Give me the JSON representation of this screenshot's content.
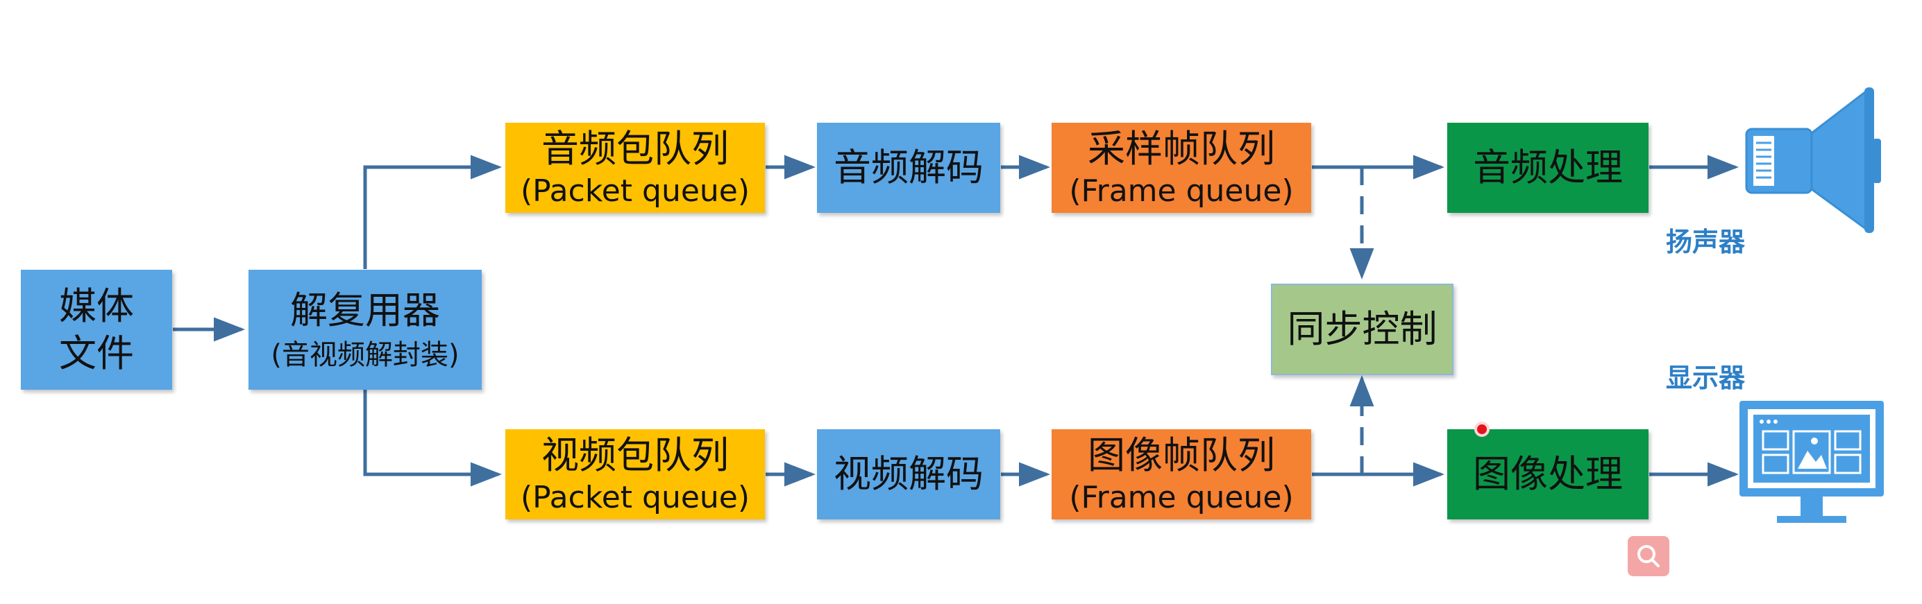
{
  "nodes": {
    "media_file": {
      "line1": "媒体",
      "line2": "文件"
    },
    "demuxer": {
      "title": "解复用器",
      "subtitle": "(音视频解封装)"
    },
    "audio_packet_queue": {
      "title": "音频包队列",
      "subtitle": "(Packet queue)"
    },
    "audio_decode": {
      "title": "音频解码"
    },
    "sample_frame_queue": {
      "title": "采样帧队列",
      "subtitle": "(Frame queue)"
    },
    "audio_processing": {
      "title": "音频处理"
    },
    "sync_control": {
      "title": "同步控制"
    },
    "video_packet_queue": {
      "title": "视频包队列",
      "subtitle": "(Packet queue)"
    },
    "video_decode": {
      "title": "视频解码"
    },
    "image_frame_queue": {
      "title": "图像帧队列",
      "subtitle": "(Frame queue)"
    },
    "image_processing": {
      "title": "图像处理"
    }
  },
  "devices": {
    "speaker": {
      "label": "扬声器",
      "icon": "speaker-icon"
    },
    "display": {
      "label": "显示器",
      "icon": "monitor-icon"
    }
  },
  "overlay": {
    "zoom_icon": "search-icon"
  },
  "colors": {
    "box_blue": "#5aa5e4",
    "queue_gold": "#ffc000",
    "frame_orange": "#f58132",
    "process_green": "#0a9648",
    "sync_green": "#a5c88a",
    "arrow": "#3f6f9f",
    "device_blue": "#4a9fe4",
    "label_blue": "#2d7fc6"
  }
}
